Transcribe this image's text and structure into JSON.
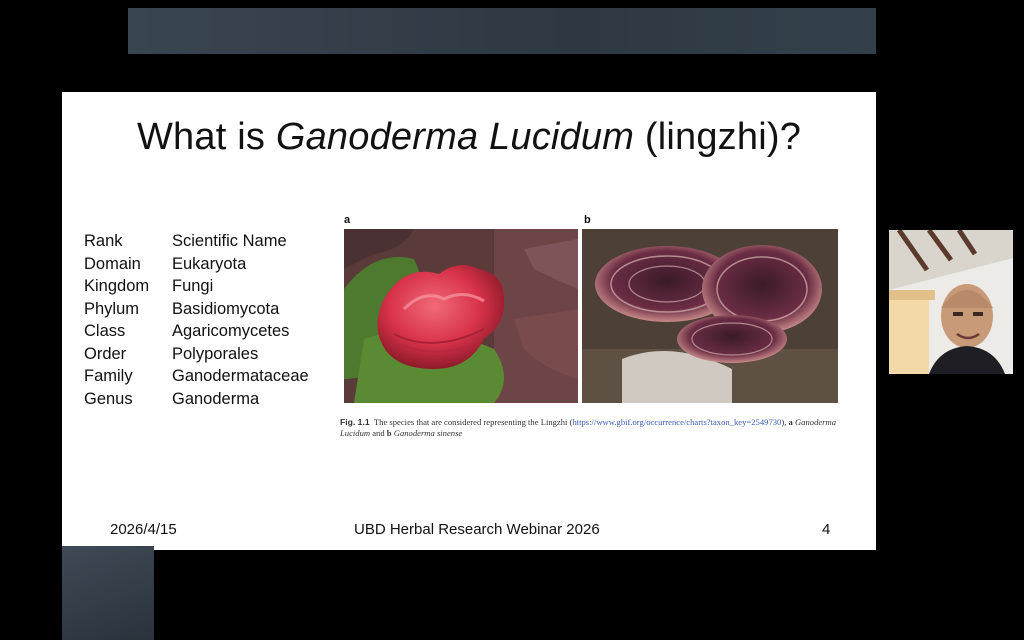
{
  "slide": {
    "title_pre": "What is ",
    "title_italic": "Ganoderma Lucidum",
    "title_post": " (lingzhi)?",
    "taxonomy": [
      [
        "Rank",
        "Scientific Name"
      ],
      [
        "Domain",
        "Eukaryota"
      ],
      [
        "Kingdom",
        "Fungi"
      ],
      [
        "Phylum",
        "Basidiomycota"
      ],
      [
        "Class",
        "Agaricomycetes"
      ],
      [
        "Order",
        "Polyporales"
      ],
      [
        "Family",
        "Ganodermataceae"
      ],
      [
        "Genus",
        "Ganoderma"
      ]
    ],
    "figure": {
      "label_a": "a",
      "label_b": "b",
      "caption_figno": "Fig. 1.1",
      "caption_text": "The species that are considered representing the Lingzhi (",
      "caption_link": "https://www.gbif.org/occurrence/charts?taxon_key=2549730",
      "caption_after_link": "), ",
      "caption_a": "a",
      "caption_a_name": "Ganoderma Lucidum",
      "caption_and": " and ",
      "caption_b": "b",
      "caption_b_name": "Ganoderma sinense"
    },
    "footer": {
      "date": "2026/4/15",
      "event": "UBD Herbal Research Webinar 2026",
      "page": "4"
    }
  },
  "colors": {
    "background": "#000000",
    "slide": "#ffffff",
    "link": "#3b5bb7"
  }
}
